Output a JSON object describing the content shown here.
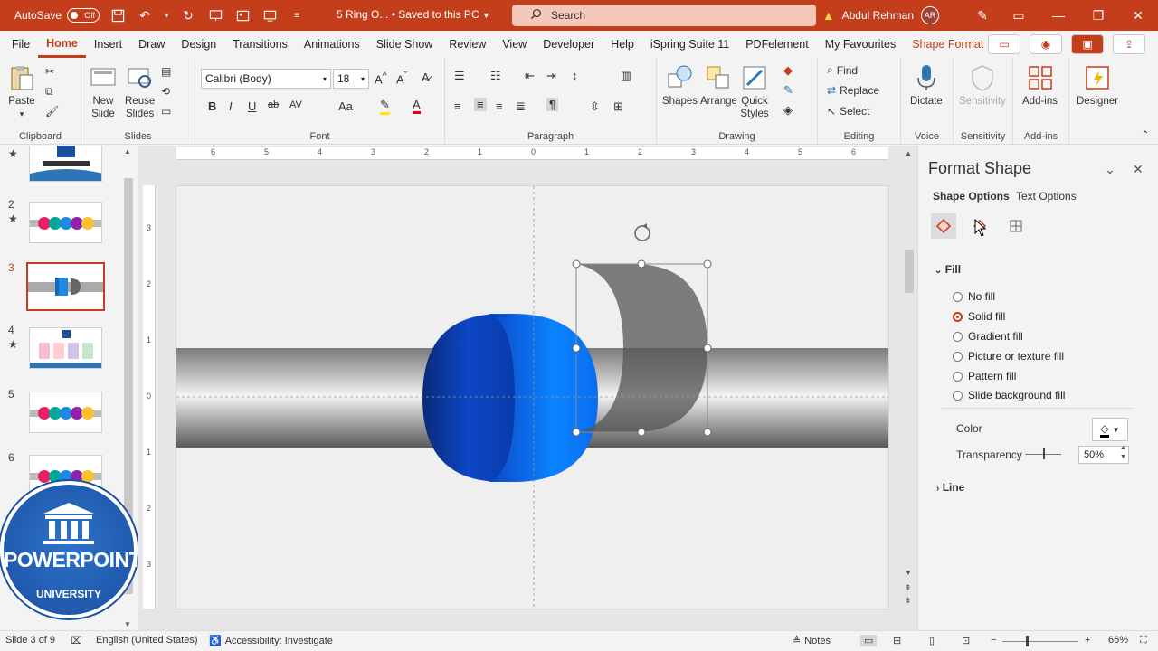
{
  "titlebar": {
    "autosave_label": "AutoSave",
    "autosave_state": "Off",
    "doc_title": "5 Ring O... • Saved to this PC",
    "search_placeholder": "Search",
    "user_name": "Abdul Rehman",
    "user_initials": "AR",
    "accent_color": "#c43e1c"
  },
  "menu": {
    "items": [
      "File",
      "Home",
      "Insert",
      "Draw",
      "Design",
      "Transitions",
      "Animations",
      "Slide Show",
      "Review",
      "View",
      "Developer",
      "Help",
      "iSpring Suite 11",
      "PDFelement",
      "My Favourites",
      "Shape Format"
    ],
    "active": "Home"
  },
  "ribbon": {
    "clipboard": {
      "paste": "Paste",
      "label": "Clipboard"
    },
    "slides": {
      "new_slide_1": "New",
      "new_slide_2": "Slide",
      "reuse_1": "Reuse",
      "reuse_2": "Slides",
      "label": "Slides"
    },
    "font": {
      "name": "Calibri (Body)",
      "size": "18",
      "label": "Font",
      "bold": "B",
      "italic": "I",
      "underline": "U",
      "strike": "ab",
      "aa": "Aa",
      "color_a": "A"
    },
    "paragraph": {
      "label": "Paragraph"
    },
    "drawing": {
      "shapes": "Shapes",
      "arrange": "Arrange",
      "quick_1": "Quick",
      "quick_2": "Styles",
      "label": "Drawing"
    },
    "editing": {
      "find": "Find",
      "replace": "Replace",
      "select": "Select",
      "label": "Editing"
    },
    "voice": {
      "dictate": "Dictate",
      "label": "Voice"
    },
    "sensitivity": {
      "btn": "Sensitivity",
      "label": "Sensitivity"
    },
    "addins": {
      "btn": "Add-ins",
      "label": "Add-ins"
    },
    "designer": {
      "btn": "Designer"
    }
  },
  "thumbnails": [
    {
      "num": "",
      "star": "★"
    },
    {
      "num": "2",
      "star": "★"
    },
    {
      "num": "3",
      "star": ""
    },
    {
      "num": "4",
      "star": "★"
    },
    {
      "num": "5",
      "star": ""
    },
    {
      "num": "6",
      "star": ""
    }
  ],
  "logo": {
    "text": "POWERPOINT",
    "sub": "UNIVERSITY"
  },
  "ruler": {
    "h_ticks": [
      "6",
      "5",
      "4",
      "3",
      "2",
      "1",
      "0",
      "1",
      "2",
      "3",
      "4",
      "5",
      "6"
    ],
    "v_ticks": [
      "3",
      "2",
      "1",
      "0",
      "1",
      "2",
      "3"
    ]
  },
  "format_pane": {
    "title": "Format Shape",
    "tab_shape": "Shape Options",
    "tab_text": "Text Options",
    "fill_section": "Fill",
    "fill_options": [
      "No fill",
      "Solid fill",
      "Gradient fill",
      "Picture or texture fill",
      "Pattern fill",
      "Slide background fill"
    ],
    "selected_fill": "Solid fill",
    "color_label": "Color",
    "transparency_label": "Transparency",
    "transparency_value": "50%",
    "transparency_fraction": 0.5,
    "line_section": "Line"
  },
  "status": {
    "slide_info": "Slide 3 of 9",
    "language": "English (United States)",
    "accessibility": "Accessibility: Investigate",
    "notes": "Notes",
    "zoom": "66%"
  }
}
